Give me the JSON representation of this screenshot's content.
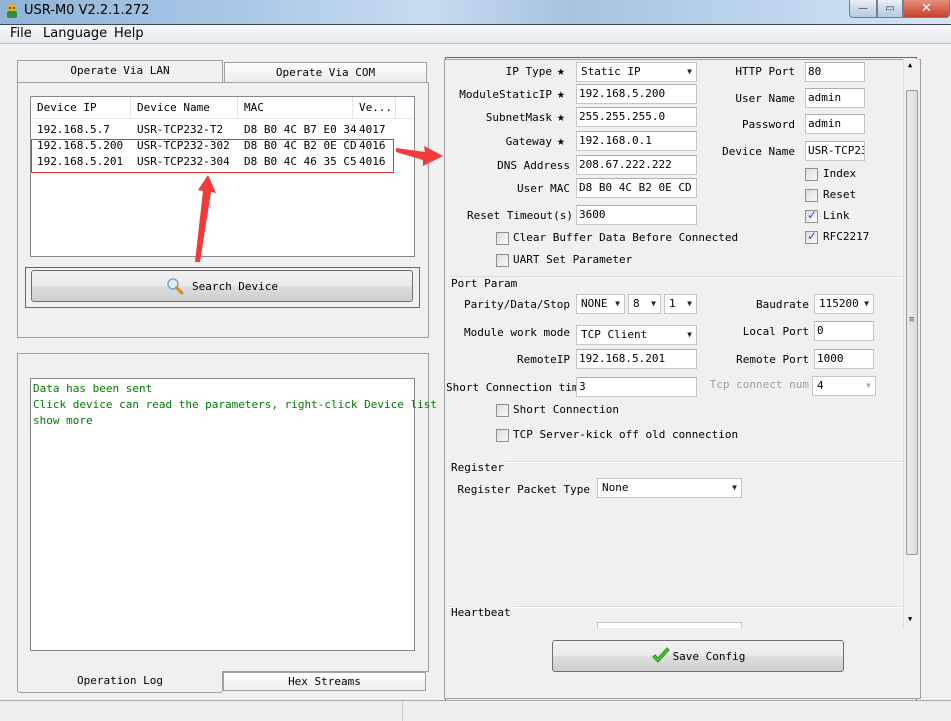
{
  "window": {
    "title": "USR-M0 V2.2.1.272",
    "controls": {
      "minimize": "—",
      "maximize": "▭",
      "close": "✕"
    }
  },
  "menu": [
    "File",
    "Language",
    "Help"
  ],
  "left": {
    "tabs": [
      "Operate Via LAN",
      "Operate Via COM"
    ],
    "active_tab": "Operate Via LAN",
    "device_list": {
      "columns": [
        "Device IP",
        "Device Name",
        "MAC",
        "Ve..."
      ],
      "rows": [
        [
          "192.168.5.7",
          "USR-TCP232-T2",
          "D8 B0 4C B7 E0 34",
          "4017"
        ],
        [
          "192.168.5.200",
          "USR-TCP232-302",
          "D8 B0 4C B2 0E CD",
          "4016"
        ],
        [
          "192.168.5.201",
          "USR-TCP232-304",
          "D8 B0 4C 46 35 C5",
          "4016"
        ]
      ]
    },
    "search_button": "Search Device",
    "log_lines": [
      " Data has been sent",
      "Click device can read the parameters, right-click Device list",
      "show more"
    ],
    "bottom_tabs": [
      "Operation Log",
      "Hex Streams"
    ],
    "active_bottom_tab": "Operation Log"
  },
  "right": {
    "ip_type": {
      "label": "IP Type",
      "value": "Static IP"
    },
    "module_static_ip": {
      "label": "ModuleStaticIP",
      "value": "192.168.5.200"
    },
    "subnet_mask": {
      "label": "SubnetMask",
      "value": "255.255.255.0"
    },
    "gateway": {
      "label": "Gateway",
      "value": "192.168.0.1"
    },
    "dns": {
      "label": "DNS Address",
      "value": "208.67.222.222"
    },
    "user_mac": {
      "label": "User MAC",
      "value": "D8 B0 4C B2 0E CD"
    },
    "reset_timeout": {
      "label": "Reset Timeout(s)",
      "value": "3600"
    },
    "clear_buffer": {
      "label": "Clear Buffer Data Before Connected",
      "checked": false
    },
    "uart_set": {
      "label": "UART Set Parameter",
      "checked": false
    },
    "http_port": {
      "label": "HTTP Port",
      "value": "80"
    },
    "user_name": {
      "label": "User Name",
      "value": "admin"
    },
    "password": {
      "label": "Password",
      "value": "admin"
    },
    "device_name": {
      "label": "Device Name",
      "value": "USR-TCP23"
    },
    "index": {
      "label": "Index",
      "checked": false
    },
    "reset": {
      "label": "Reset",
      "checked": false
    },
    "link": {
      "label": "Link",
      "checked": true
    },
    "rfc2217": {
      "label": "RFC2217",
      "checked": true
    },
    "port_param": {
      "title": "Port Param",
      "parity_label": "Parity/Data/Stop",
      "parity": "NONE",
      "data_bits": "8",
      "stop_bits": "1",
      "baudrate_label": "Baudrate",
      "baudrate": "115200",
      "work_mode_label": "Module work mode",
      "work_mode": "TCP Client",
      "local_port_label": "Local Port",
      "local_port": "0",
      "remote_ip_label": "RemoteIP",
      "remote_ip": "192.168.5.201",
      "remote_port_label": "Remote Port",
      "remote_port": "1000",
      "short_conn_time_label": "Short Connection time",
      "short_conn_time": "3",
      "tcp_connect_num_label": "Tcp connect num",
      "tcp_connect_num": "4",
      "short_connection": {
        "label": "Short Connection",
        "checked": false
      },
      "kick_off": {
        "label": "TCP Server-kick off old connection",
        "checked": false
      }
    },
    "register": {
      "title": "Register",
      "packet_type_label": "Register Packet Type",
      "packet_type": "None"
    },
    "heartbeat": {
      "title": "Heartbeat"
    },
    "save_button": "Save Config"
  },
  "colors": {
    "annotation_red": "#e8323a",
    "log_green": "#007a00",
    "checkbox_blue": "#2a5ea8"
  }
}
